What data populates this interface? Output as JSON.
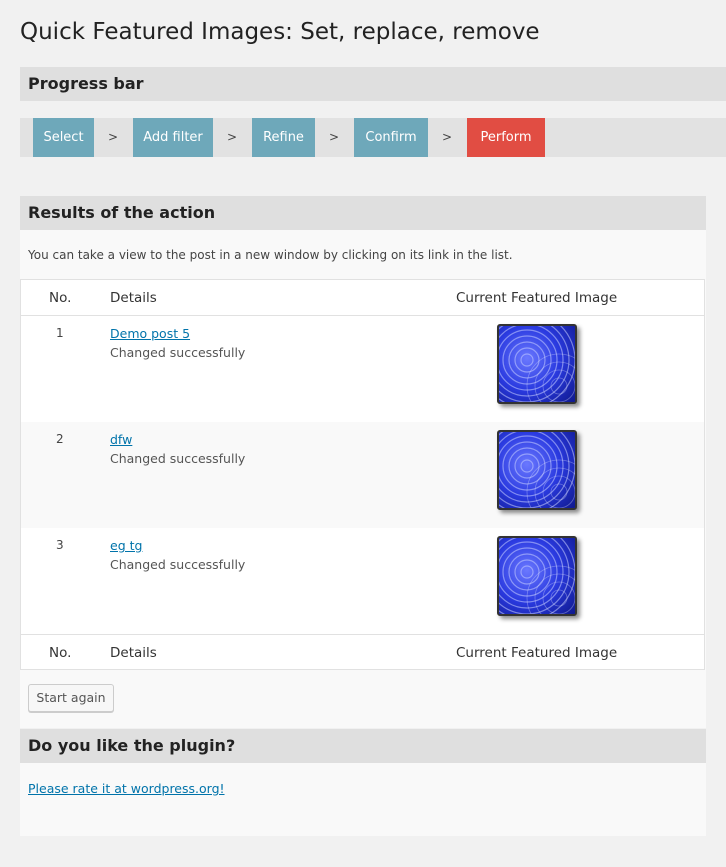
{
  "page": {
    "title": "Quick Featured Images: Set, replace, remove"
  },
  "progress": {
    "heading": "Progress bar",
    "separator": ">",
    "steps": [
      {
        "label": "Select",
        "state": "done"
      },
      {
        "label": "Add filter",
        "state": "done"
      },
      {
        "label": "Refine",
        "state": "done"
      },
      {
        "label": "Confirm",
        "state": "done"
      },
      {
        "label": "Perform",
        "state": "current"
      }
    ]
  },
  "results": {
    "heading": "Results of the action",
    "intro": "You can take a view to the post in a new window by clicking on its link in the list.",
    "columns": {
      "no": "No.",
      "details": "Details",
      "image": "Current Featured Image"
    },
    "rows": [
      {
        "no": "1",
        "title": "Demo post 5",
        "status": "Changed successfully"
      },
      {
        "no": "2",
        "title": "dfw",
        "status": "Changed successfully"
      },
      {
        "no": "3",
        "title": "eg tg",
        "status": "Changed successfully"
      }
    ],
    "start_again_label": "Start again"
  },
  "like": {
    "heading": "Do you like the plugin?",
    "rate_link": "Please rate it at wordpress.org!"
  },
  "colors": {
    "step_done": "#6ea8ba",
    "step_current": "#e14d43",
    "link": "#0073aa"
  }
}
